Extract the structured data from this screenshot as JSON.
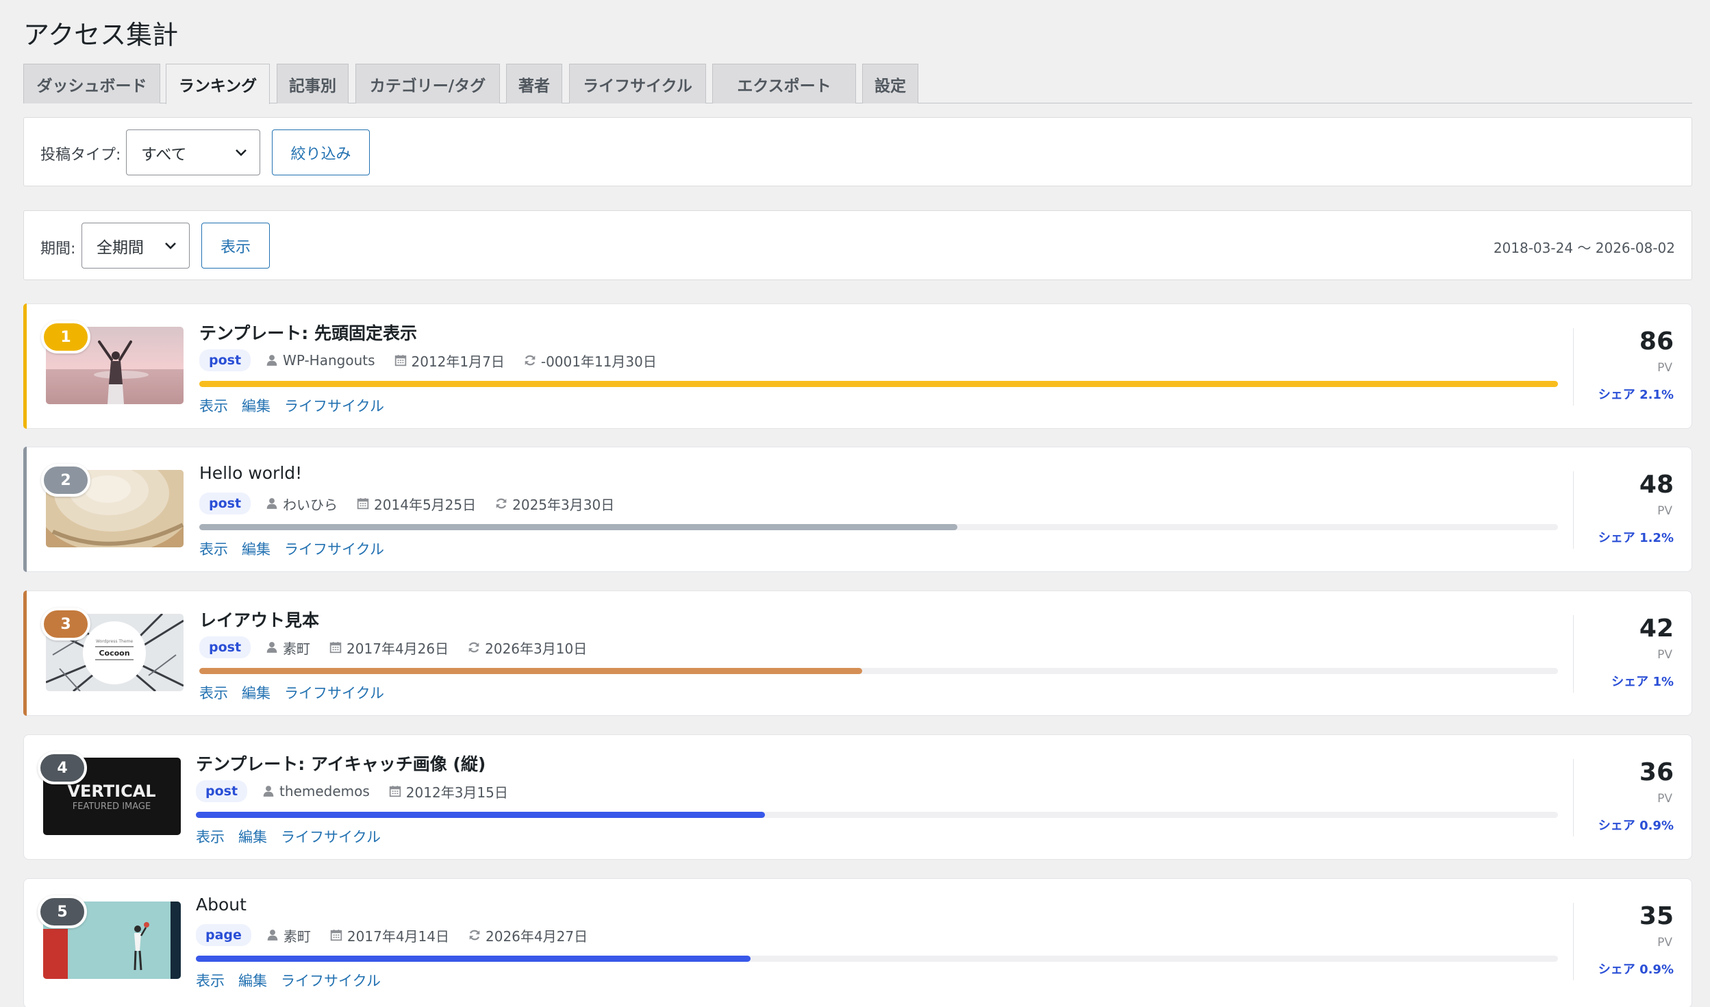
{
  "page_title": "アクセス集計",
  "tabs": [
    {
      "label": "ダッシュボード",
      "active": false
    },
    {
      "label": "ランキング",
      "active": true
    },
    {
      "label": "記事別",
      "active": false
    },
    {
      "label": "カテゴリー/タグ",
      "active": false
    },
    {
      "label": "著者",
      "active": false
    },
    {
      "label": "ライフサイクル",
      "active": false
    },
    {
      "label": "エクスポート",
      "active": false
    },
    {
      "label": "設定",
      "active": false
    }
  ],
  "filter": {
    "post_type_label": "投稿タイプ:",
    "post_type_value": "すべて",
    "submit_label": "絞り込み"
  },
  "period": {
    "label": "期間:",
    "value": "全期間",
    "submit_label": "表示",
    "range_text": "2018-03-24 〜 2026-08-02"
  },
  "ranking": [
    {
      "rank": "1",
      "title": "テンプレート: 先頭固定表示",
      "type": "post",
      "author": "WP-Hangouts",
      "published": "2012年1月7日",
      "modified": "-0001年11月30日",
      "pv": "86",
      "pv_unit": "PV",
      "share": "シェア 2.1%",
      "bar_fraction": 1.0,
      "color": "#f0b400",
      "bar_color": "#f8bd1d"
    },
    {
      "rank": "2",
      "title": "Hello world!",
      "type": "post",
      "author": "わいひら",
      "published": "2014年5月25日",
      "modified": "2025年3月30日",
      "pv": "48",
      "pv_unit": "PV",
      "share": "シェア 1.2%",
      "bar_fraction": 0.558,
      "color": "#8c959f",
      "bar_color": "#a7afb8"
    },
    {
      "rank": "3",
      "title": "レイアウト見本",
      "type": "post",
      "author": "素町",
      "published": "2017年4月26日",
      "modified": "2026年3月10日",
      "pv": "42",
      "pv_unit": "PV",
      "share": "シェア 1%",
      "bar_fraction": 0.488,
      "color": "#c47a3d",
      "bar_color": "#d58f55"
    },
    {
      "rank": "4",
      "title": "テンプレート: アイキャッチ画像 (縦)",
      "type": "post",
      "author": "themedemos",
      "published": "2012年3月15日",
      "modified": "",
      "pv": "36",
      "pv_unit": "PV",
      "share": "シェア 0.9%",
      "bar_fraction": 0.418,
      "color": "#50575e",
      "bar_color": "#3858e9"
    },
    {
      "rank": "5",
      "title": "About",
      "type": "page",
      "author": "素町",
      "published": "2017年4月14日",
      "modified": "2026年4月27日",
      "pv": "35",
      "pv_unit": "PV",
      "share": "シェア 0.9%",
      "bar_fraction": 0.407,
      "color": "#50575e",
      "bar_color": "#3858e9"
    }
  ],
  "row_actions": {
    "view": "表示",
    "edit": "編集",
    "lifecycle": "ライフサイクル"
  },
  "thumb_texts": {
    "vertical_title": "VERTICAL",
    "vertical_sub": "FEATURED IMAGE",
    "cocoon": "Cocoon"
  }
}
